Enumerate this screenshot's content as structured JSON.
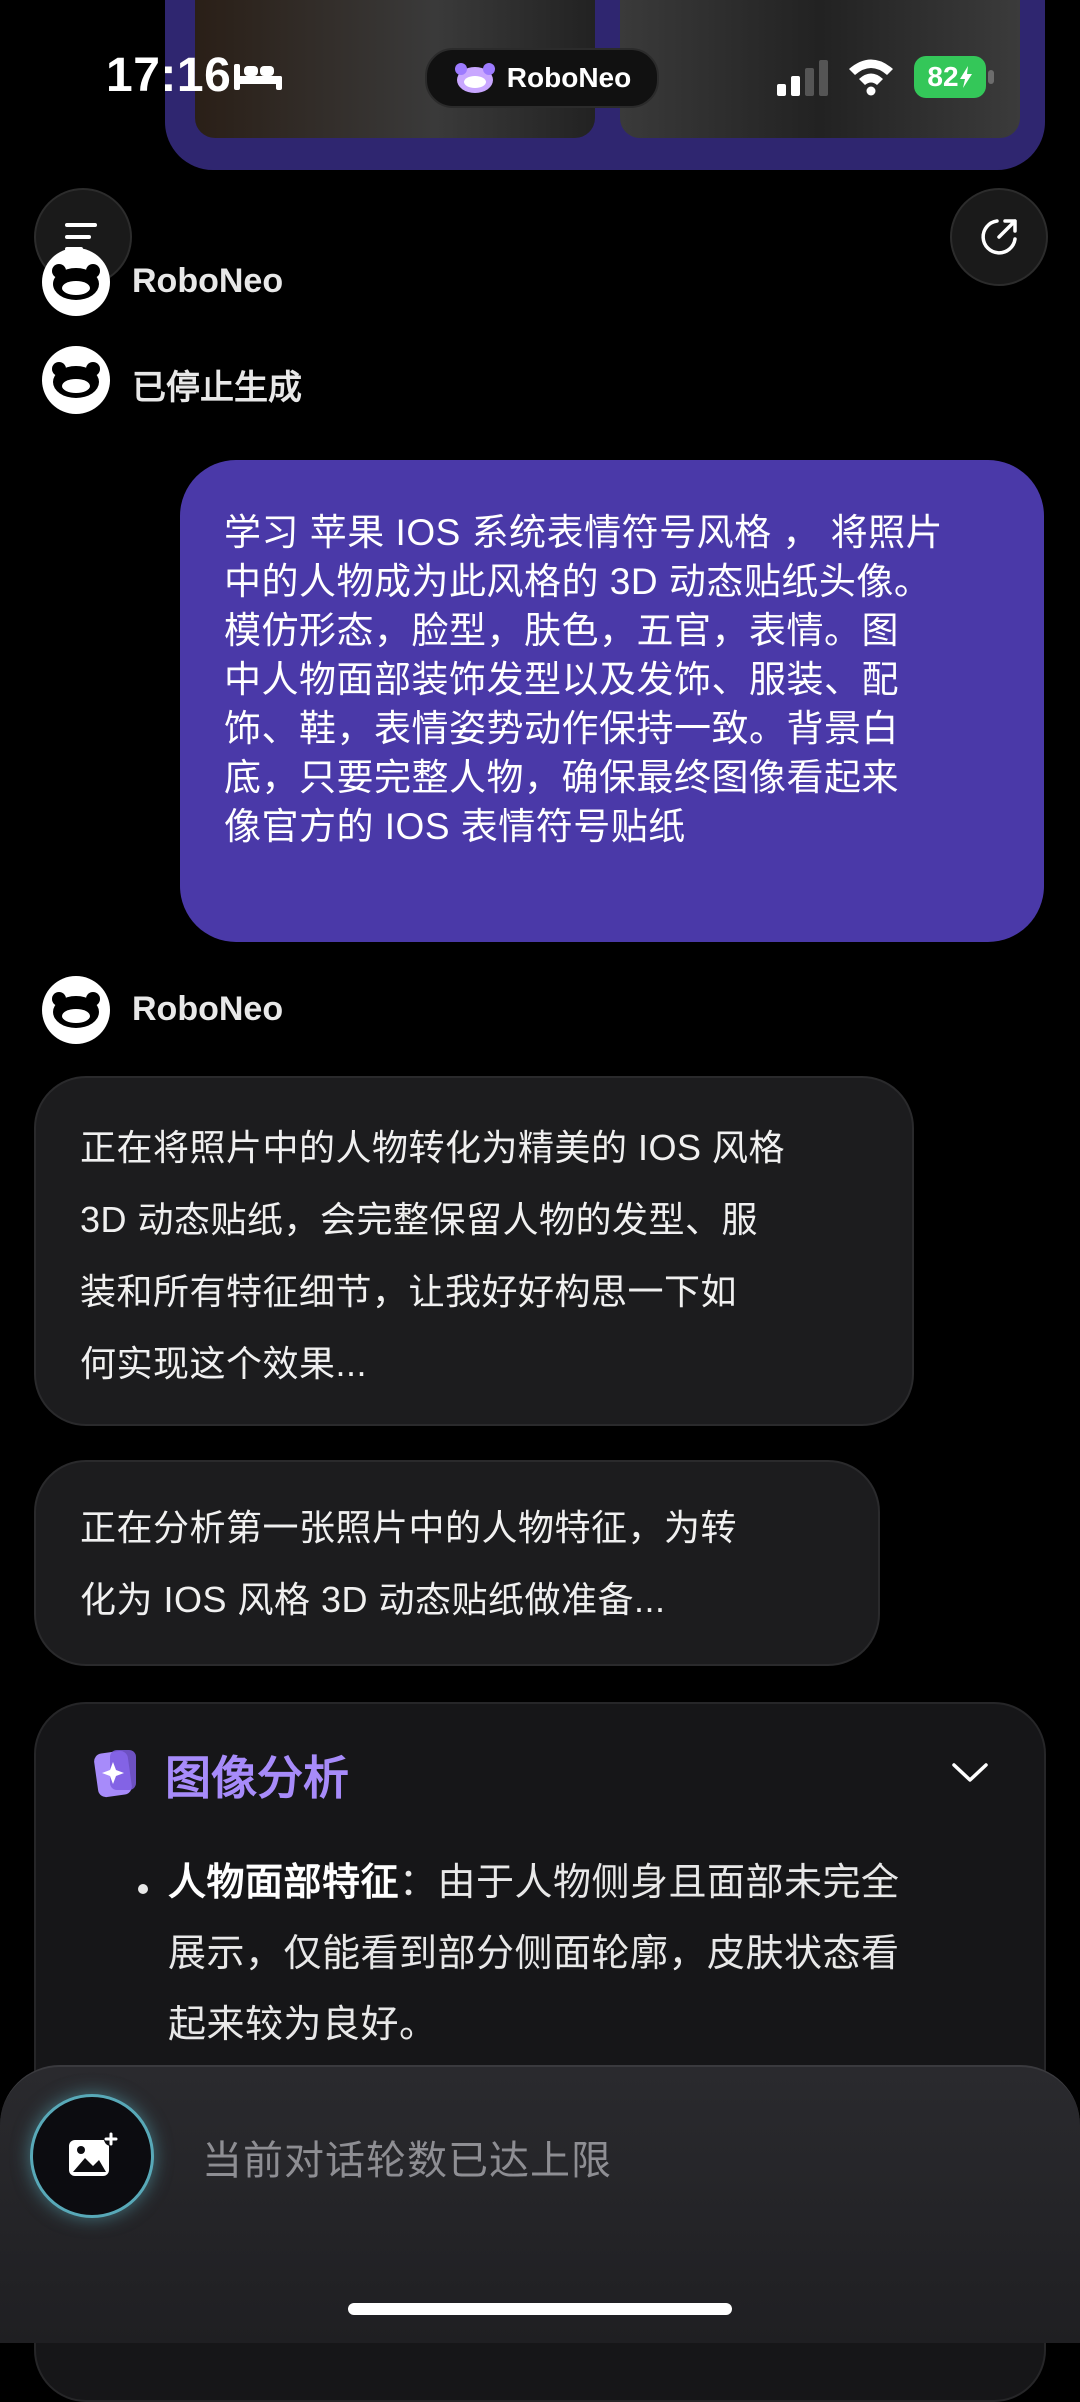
{
  "status_bar": {
    "time": "17:16",
    "brand": "RoboNeo",
    "battery": "82",
    "battery_color": "#34c759"
  },
  "header": {
    "menu_icon": "menu-icon",
    "share_icon": "share-icon"
  },
  "messages": {
    "assistant_name": "RoboNeo",
    "stopped_text": "已停止生成",
    "user_lines": [
      "学习 苹果 IOS 系统表情符号风格 ， 将照片",
      "中的人物成为此风格的 3D 动态贴纸头像。",
      "模仿形态，脸型，肤色，五官，表情。图",
      "中人物面部装饰发型以及发饰、服装、配",
      "饰、鞋，表情姿势动作保持一致。背景白",
      "底，只要完整人物，确保最终图像看起来",
      "像官方的 IOS 表情符号贴纸"
    ],
    "ai_name_2": "RoboNeo",
    "ai_bubble_1_lines": [
      "正在将照片中的人物转化为精美的 IOS 风格",
      "3D 动态贴纸，会完整保留人物的发型、服",
      "装和所有特征细节，让我好好构思一下如",
      "何实现这个效果..."
    ],
    "ai_bubble_2_lines": [
      "正在分析第一张照片中的人物特征，为转",
      "化为 IOS 风格 3D 动态贴纸做准备..."
    ]
  },
  "analysis": {
    "title": "图像分析",
    "accent_color": "#a78bfa",
    "bullet_label": "人物面部特征",
    "bullet_colon": "：",
    "bullet_lines": [
      "由于人物侧身且面部未完全",
      "展示，仅能看到部分侧面轮廓，皮肤状态看",
      "起来较为良好。"
    ]
  },
  "input": {
    "placeholder": "当前对话轮数已达上限"
  },
  "colors": {
    "user_bubble": "#4a39a8",
    "ai_bubble": "#1c1c1e"
  }
}
